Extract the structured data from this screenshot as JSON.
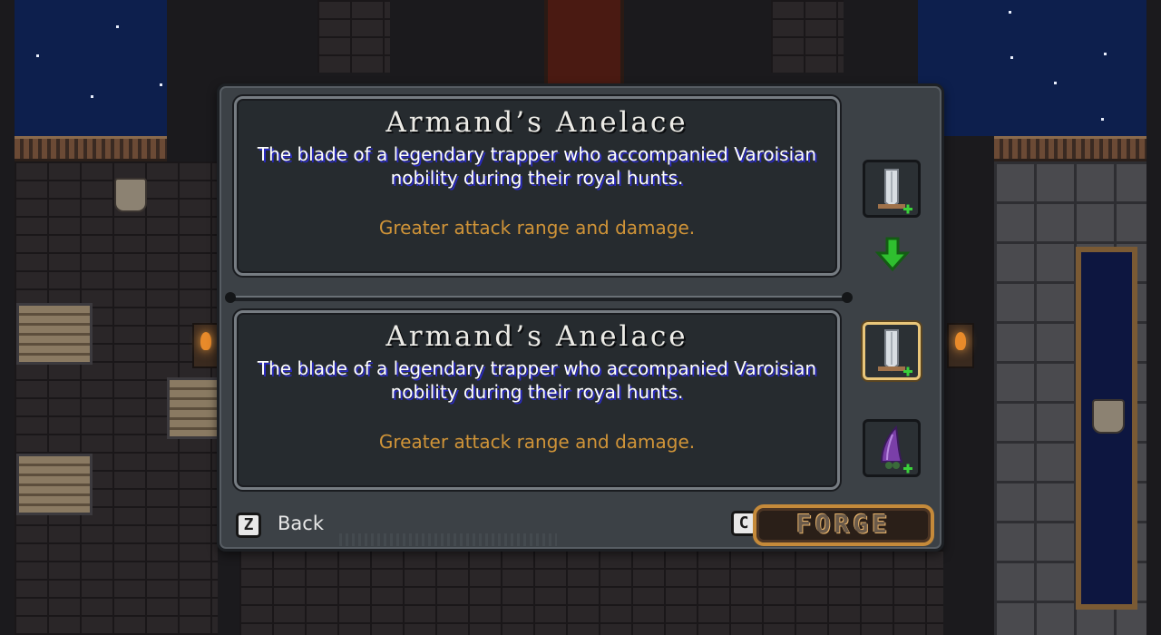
{
  "dialog": {
    "current_item": {
      "name": "Armand’s Anelace",
      "description": "The blade of a legendary trapper who accompanied Varoisian nobility during their royal hunts.",
      "effect": "Greater attack range and damage."
    },
    "selected_item": {
      "name": "Armand’s Anelace",
      "description": "The blade of a legendary trapper who accompanied Varoisian nobility during their royal hunts.",
      "effect": "Greater attack range and damage."
    },
    "slots": [
      {
        "icon": "dagger-icon",
        "badge": "+",
        "selected": false,
        "role": "equipped"
      },
      {
        "icon": "dagger-icon",
        "badge": "+",
        "selected": true,
        "role": "option"
      },
      {
        "icon": "purple-claw-icon",
        "badge": "+",
        "selected": false,
        "role": "option"
      }
    ],
    "back": {
      "key": "Z",
      "label": "Back"
    },
    "forge": {
      "key": "C",
      "label": "FORGE"
    }
  },
  "colors": {
    "effect_text": "#d09438",
    "name_text": "#ecebe6",
    "upgrade_badge": "#3ad13a",
    "arrow": "#2fbf2f",
    "selected_border": "#e9c67a"
  }
}
